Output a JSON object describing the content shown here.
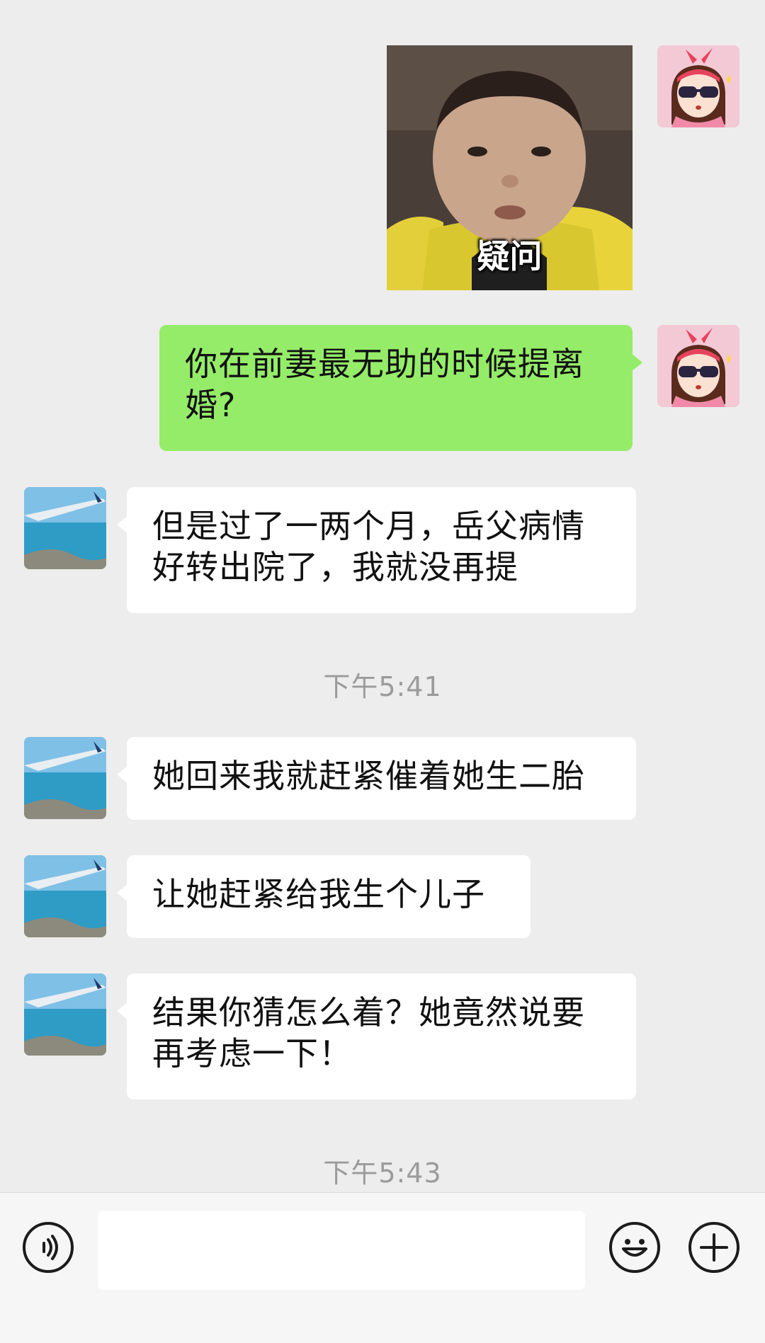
{
  "messages": [
    {
      "sender": "me",
      "type": "sticker",
      "caption": "疑问"
    },
    {
      "sender": "me",
      "type": "text",
      "text_line1": "你在前妻最无助的时候提离",
      "text_line2": "婚?"
    },
    {
      "sender": "them",
      "type": "text",
      "text_line1": "但是过了一两个月，岳父病情",
      "text_line2": "好转出院了，我就没再提"
    },
    {
      "type": "timestamp",
      "text": "下午5:41"
    },
    {
      "sender": "them",
      "type": "text",
      "text_line1": "她回来我就赶紧催着她生二胎"
    },
    {
      "sender": "them",
      "type": "text",
      "text_line1": "让她赶紧给我生个儿子"
    },
    {
      "sender": "them",
      "type": "text",
      "text_line1": "结果你猜怎么着？她竟然说要",
      "text_line2": "再考虑一下！"
    },
    {
      "type": "timestamp",
      "text": "下午5:43"
    }
  ],
  "input_bar": {
    "voice_icon": "voice-icon",
    "emoji_icon": "smiley-icon",
    "plus_icon": "plus-icon",
    "input_value": ""
  },
  "colors": {
    "my_bubble": "#95ec69",
    "their_bubble": "#ffffff",
    "background": "#ededed",
    "timestamp": "#9b9b9b"
  }
}
